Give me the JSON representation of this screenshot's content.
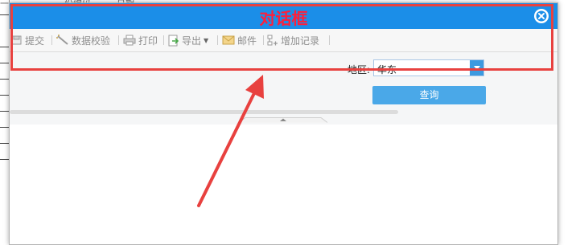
{
  "background": {
    "top_fragments": [
      "一",
      "份编码",
      "日期"
    ]
  },
  "dialog": {
    "title": "对话框",
    "title_color": "#ff1f3a",
    "titlebar_color": "#1b8ee8",
    "close_icon": "close-circle-icon"
  },
  "toolbar": {
    "items": [
      {
        "label": "提交",
        "icon": "submit-icon"
      },
      {
        "label": "数据校验",
        "icon": "magic-wand-icon"
      },
      {
        "label": "打印",
        "icon": "printer-icon"
      },
      {
        "label": "导出",
        "icon": "export-icon"
      },
      {
        "label": "邮件",
        "icon": "mail-icon"
      },
      {
        "label": "增加记录",
        "icon": "add-record-icon"
      }
    ]
  },
  "query": {
    "region_label": "地区:",
    "region_value": "华东",
    "query_button": "查询"
  },
  "annotation": {
    "color": "#e8413f"
  }
}
